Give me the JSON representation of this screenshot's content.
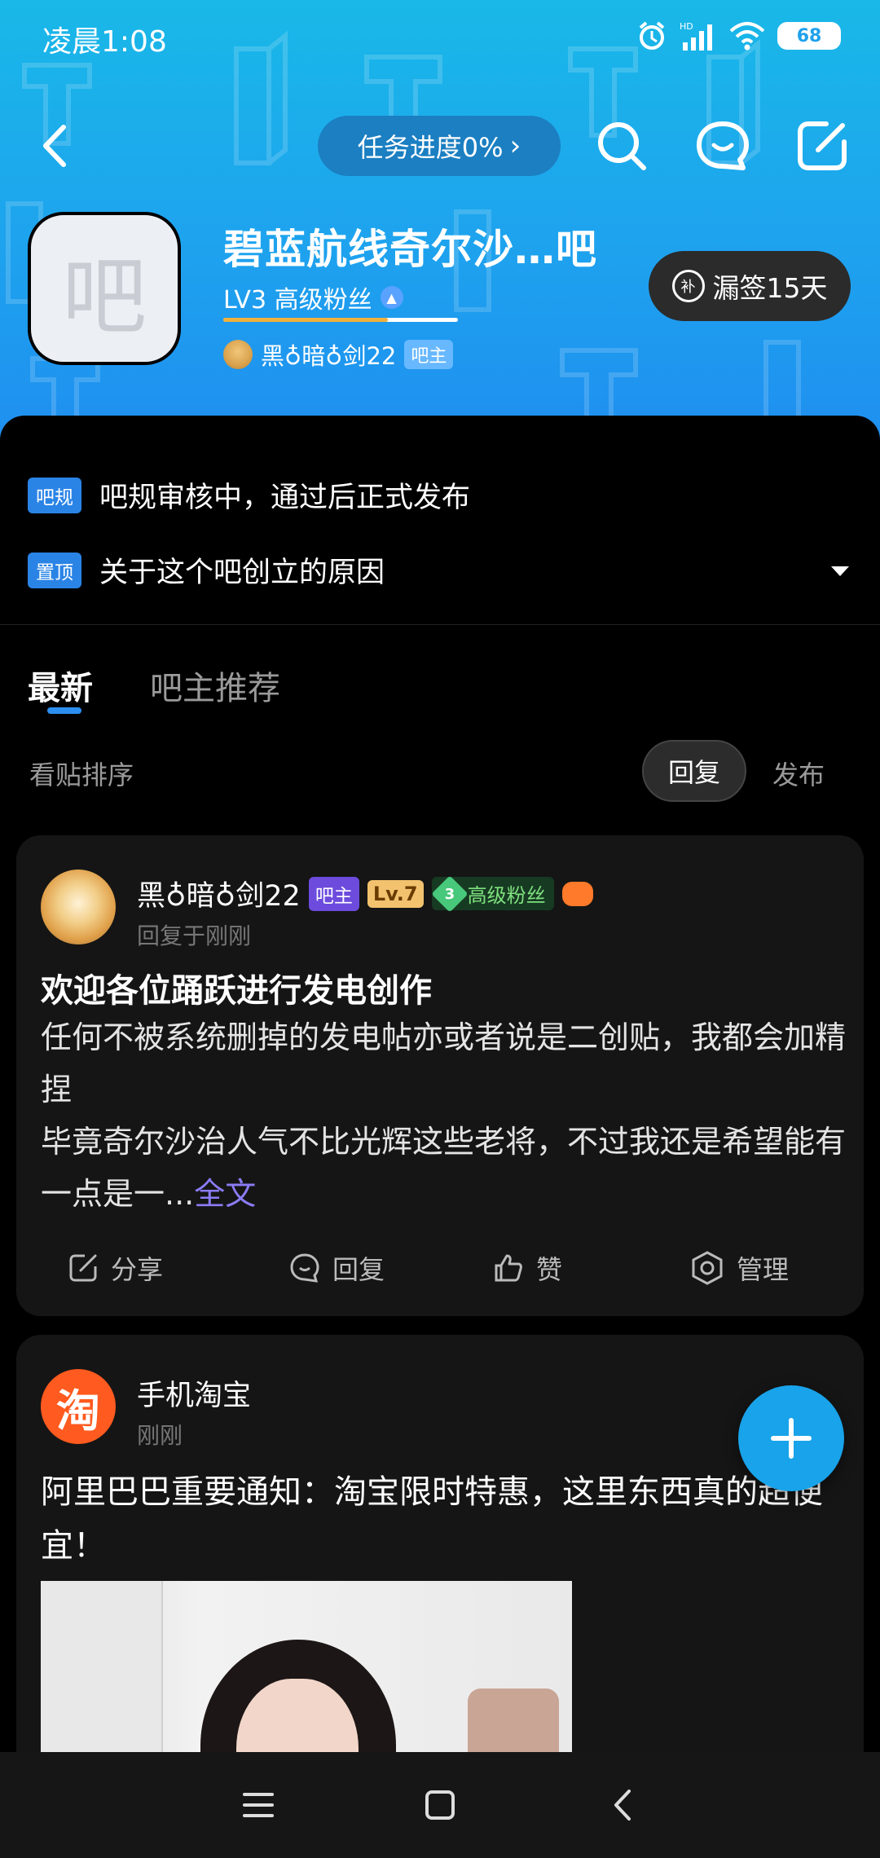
{
  "status_bar": {
    "time": "凌晨1:08",
    "battery": "68"
  },
  "header": {
    "task_progress": "任务进度0%",
    "forum": {
      "avatar_char": "吧",
      "title": "碧蓝航线奇尔沙…吧",
      "level": "LV3 高级粉丝",
      "owner_name": "黑♁暗♁剑22",
      "owner_tag": "吧主",
      "sign_label": "漏签15天",
      "sign_icon_char": "补"
    }
  },
  "notices": [
    {
      "badge": "吧规",
      "text": "吧规审核中，通过后正式发布"
    },
    {
      "badge": "置顶",
      "text": "关于这个吧创立的原因"
    }
  ],
  "tabs": [
    {
      "label": "最新",
      "active": true
    },
    {
      "label": "吧主推荐",
      "active": false
    }
  ],
  "sort": {
    "label": "看贴排序",
    "reply": "回复",
    "post": "发布"
  },
  "posts": [
    {
      "author": "黑♁暗♁剑22",
      "owner_tag": "吧主",
      "level_tag": "Lv.7",
      "fan_level": "3",
      "fan_tag": "高级粉丝",
      "meta": "回复于刚刚",
      "title": "欢迎各位踊跃进行发电创作",
      "body_line1": "任何不被系统删掉的发电帖亦或者说是二创贴，我都会加精捏",
      "body_line2": "毕竟奇尔沙治人气不比光辉这些老将，不过我还是希望能有一点是一...",
      "more": "全文",
      "actions": {
        "share": "分享",
        "reply": "回复",
        "like": "赞",
        "manage": "管理"
      }
    },
    {
      "author": "手机淘宝",
      "avatar_char": "淘",
      "meta": "刚刚",
      "body": "阿里巴巴重要通知：淘宝限时特惠，这里东西真的超便宜！"
    }
  ],
  "colors": {
    "header_top": "#19b8e8",
    "header_bottom": "#1f8ff0",
    "accent": "#2c8ff0",
    "fab": "#18a3ea"
  }
}
